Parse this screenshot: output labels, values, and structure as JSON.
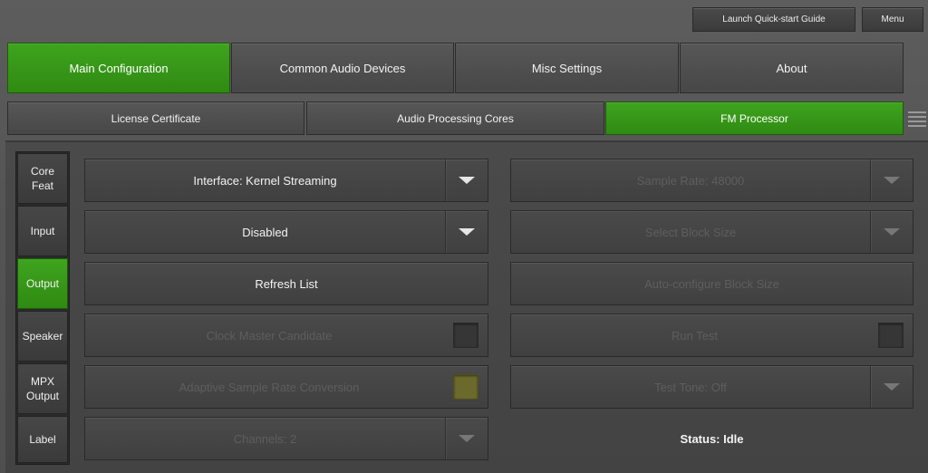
{
  "top": {
    "quickstart_label": "Launch Quick-start Guide",
    "menu_label": "Menu"
  },
  "tabs_main": [
    {
      "label": "Main Configuration",
      "active": true
    },
    {
      "label": "Common Audio Devices",
      "active": false
    },
    {
      "label": "Misc Settings",
      "active": false
    },
    {
      "label": "About",
      "active": false
    }
  ],
  "tabs_sub": [
    {
      "label": "License Certificate",
      "active": false
    },
    {
      "label": "Audio Processing Cores",
      "active": false
    },
    {
      "label": "FM Processor",
      "active": true
    }
  ],
  "sidebar": [
    {
      "label": "Core\nFeat",
      "active": false
    },
    {
      "label": "Input",
      "active": false
    },
    {
      "label": "Output",
      "active": true
    },
    {
      "label": "Speaker",
      "active": false
    },
    {
      "label": "MPX\nOutput",
      "active": false
    },
    {
      "label": "Label",
      "active": false
    }
  ],
  "left_controls": {
    "interface": "Interface: Kernel Streaming",
    "mode": "Disabled",
    "refresh": "Refresh List",
    "clock_master": "Clock Master Candidate",
    "adaptive_src": "Adaptive Sample Rate Conversion",
    "channels": "Channels: 2"
  },
  "right_controls": {
    "sample_rate": "Sample Rate: 48000",
    "block_size": "Select Block Size",
    "auto_block": "Auto-configure Block Size",
    "run_test": "Run Test",
    "test_tone": "Test Tone: Off",
    "status": "Status: Idle"
  },
  "icons": {
    "dropdown": "chevron-down-icon",
    "grip": "menu-grip-icon"
  },
  "colors": {
    "accent_green": "#3a9a1a"
  }
}
